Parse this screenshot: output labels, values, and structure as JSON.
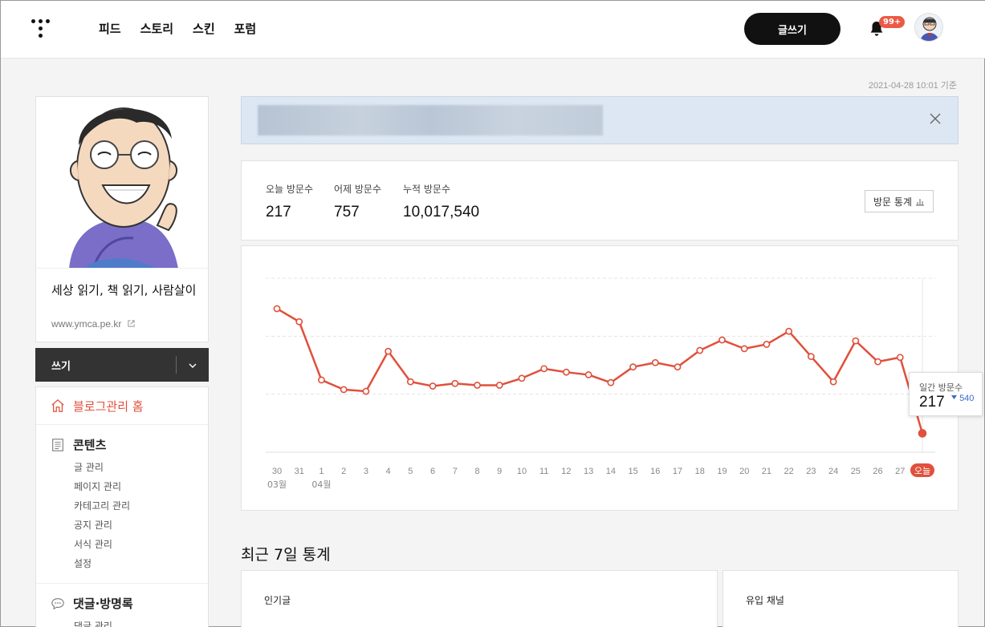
{
  "header": {
    "nav": [
      "피드",
      "스토리",
      "스킨",
      "포럼"
    ],
    "write_button": "글쓰기",
    "notification_count": "99+"
  },
  "timestamp": "2021-04-28 10:01 기준",
  "sidebar": {
    "blog_title": "세상 읽기, 책 읽기, 사람살이",
    "blog_url": "www.ymca.pe.kr",
    "write_label": "쓰기",
    "home_label": "블로그관리 홈",
    "contents": {
      "title": "콘텐츠",
      "items": [
        "글 관리",
        "페이지 관리",
        "카테고리 관리",
        "공지 관리",
        "서식 관리",
        "설정"
      ]
    },
    "comments": {
      "title": "댓글·방명록",
      "items": [
        "댓글 관리"
      ]
    }
  },
  "stats": {
    "today_label": "오늘 방문수",
    "today_value": "217",
    "yesterday_label": "어제 방문수",
    "yesterday_value": "757",
    "total_label": "누적 방문수",
    "total_value": "10,017,540",
    "stats_button": "방문 통계"
  },
  "tooltip": {
    "title": "일간 방문수",
    "value": "217",
    "delta": "540"
  },
  "chart_data": {
    "type": "line",
    "x": [
      "30",
      "31",
      "1",
      "2",
      "3",
      "4",
      "5",
      "6",
      "7",
      "8",
      "9",
      "10",
      "11",
      "12",
      "13",
      "14",
      "15",
      "16",
      "17",
      "18",
      "19",
      "20",
      "21",
      "22",
      "23",
      "24",
      "25",
      "26",
      "27",
      "오늘"
    ],
    "month_labels": [
      {
        "at": 0,
        "label": "03월"
      },
      {
        "at": 2,
        "label": "04월"
      }
    ],
    "values": [
      1650,
      1500,
      830,
      720,
      700,
      1160,
      810,
      760,
      790,
      770,
      770,
      850,
      960,
      920,
      890,
      800,
      980,
      1030,
      980,
      1170,
      1290,
      1190,
      1240,
      1390,
      1100,
      810,
      1280,
      1040,
      1090,
      217
    ],
    "ylim": [
      0,
      2000
    ],
    "grid": true,
    "color": "#e0503c",
    "highlight_color": "#e0503c"
  },
  "recent": {
    "title": "최근 7일 통계",
    "popular": "인기글",
    "channels": "유입 채널"
  }
}
